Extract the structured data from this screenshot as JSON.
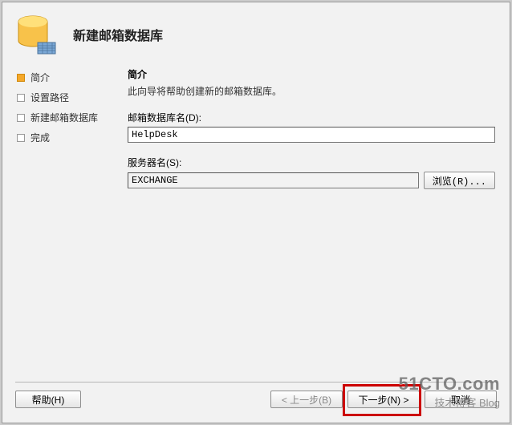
{
  "header": {
    "title": "新建邮箱数据库"
  },
  "sidebar": {
    "steps": [
      {
        "label": "简介",
        "active": true
      },
      {
        "label": "设置路径",
        "active": false
      },
      {
        "label": "新建邮箱数据库",
        "active": false
      },
      {
        "label": "完成",
        "active": false
      }
    ]
  },
  "content": {
    "section_title": "简介",
    "section_desc": "此向导将帮助创建新的邮箱数据库。",
    "db_name_label": "邮箱数据库名(D):",
    "db_name_value": "HelpDesk",
    "server_label": "服务器名(S):",
    "server_value": "EXCHANGE",
    "browse_label": "浏览(R)..."
  },
  "footer": {
    "help": "帮助(H)",
    "back": "< 上一步(B)",
    "next": "下一步(N) >",
    "cancel": "取消"
  },
  "watermark": {
    "main": "51CTO.com",
    "sub": "技术博客 Blog"
  }
}
